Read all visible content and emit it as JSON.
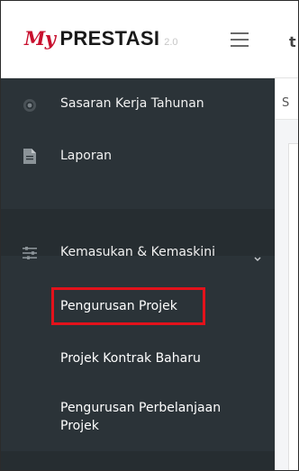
{
  "header": {
    "logo": {
      "my": "My",
      "name": "PRESTASI",
      "version": "2.0"
    },
    "clipped_text": "t"
  },
  "sidebar": {
    "items": [
      {
        "label": "Sasaran Kerja Tahunan",
        "icon": "target-icon"
      },
      {
        "label": "Laporan",
        "icon": "document-icon"
      },
      {
        "label": "Kemasukan & Kemaskini",
        "icon": "sliders-icon",
        "expanded": true
      }
    ],
    "submenu": [
      {
        "label": "Pengurusan Projek",
        "highlighted": true
      },
      {
        "label": "Projek Kontrak Baharu"
      },
      {
        "label": "Pengurusan Perbelanjaan Projek"
      }
    ]
  },
  "content": {
    "clipped_text": "S"
  },
  "colors": {
    "sidebar_bg": "#2b3338",
    "highlight": "#e3121b",
    "logo_accent": "#c8102e"
  }
}
